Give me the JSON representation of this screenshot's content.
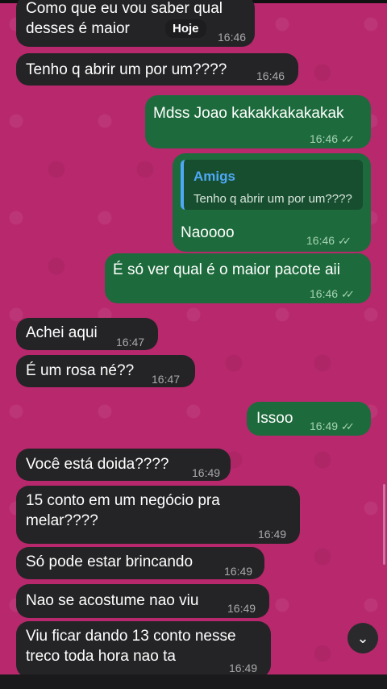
{
  "date_pill": "Hoje",
  "messages": [
    {
      "dir": "in",
      "text": "Como que eu vou saber qual\ndesses é maior",
      "time": "16:46"
    },
    {
      "dir": "in",
      "text": "Tenho q abrir um por um????",
      "time": "16:46"
    },
    {
      "dir": "out",
      "text": "Mdss Joao kakakkakakakak",
      "time": "16:46"
    },
    {
      "dir": "out",
      "reply_name": "Amigs",
      "reply_text": "Tenho q abrir um por um????",
      "text": "Naoooo",
      "time": "16:46"
    },
    {
      "dir": "out",
      "text": "É só ver qual é o maior pacote aii",
      "time": "16:46"
    },
    {
      "dir": "in",
      "text": "Achei aqui",
      "time": "16:47"
    },
    {
      "dir": "in",
      "text": "É um rosa né??",
      "time": "16:47"
    },
    {
      "dir": "out",
      "text": "Issoo",
      "time": "16:49"
    },
    {
      "dir": "in",
      "text": "Você está doida????",
      "time": "16:49"
    },
    {
      "dir": "in",
      "text": "15 conto em um negócio pra\nmelar????",
      "time": "16:49"
    },
    {
      "dir": "in",
      "text": "Só pode estar brincando",
      "time": "16:49"
    },
    {
      "dir": "in",
      "text": "Nao se acostume nao viu",
      "time": "16:49"
    },
    {
      "dir": "in",
      "text": "Viu ficar dando 13 conto nesse\ntreco toda hora nao ta",
      "time": "16:49"
    }
  ],
  "read_ticks": "✓✓",
  "scroll_icon": "chevron-down-icon",
  "scroll_glyph": "⌄",
  "colors": {
    "wallpaper": "#b8286d",
    "incoming": "#242426",
    "outgoing": "#1d6b3c",
    "reply_accent": "#4ea8f5"
  }
}
